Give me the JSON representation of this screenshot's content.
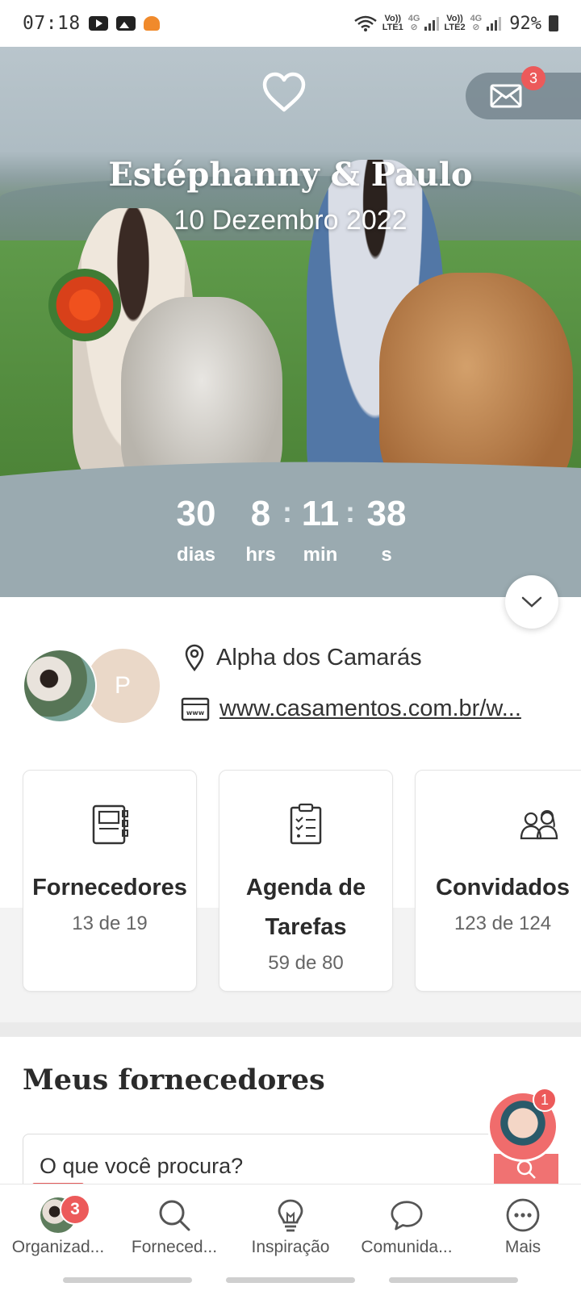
{
  "status_bar": {
    "time": "07:18",
    "net1_top": "Vo))",
    "net1_bottom": "LTE1",
    "net2_top": "Vo))",
    "net2_bottom": "LTE2",
    "net_type": "4G",
    "battery": "92%"
  },
  "header": {
    "couple": "Estéphanny & Paulo",
    "date": "10 Dezembro 2022",
    "messages_badge": "3"
  },
  "countdown": {
    "days": "30",
    "days_label": "dias",
    "hours": "8",
    "hours_label": "hrs",
    "minutes": "11",
    "minutes_label": "min",
    "seconds": "38",
    "seconds_label": "s",
    "separator": ":"
  },
  "profile": {
    "partner_initial": "P",
    "location": "Alpha dos Camarás",
    "website": "www.casamentos.com.br/w..."
  },
  "cards": [
    {
      "title": "Fornecedores",
      "count": "13 de 19",
      "icon": "notebook-icon"
    },
    {
      "title_line1": "Agenda de",
      "title_line2": "Tarefas",
      "count": "59 de 80",
      "icon": "clipboard-checklist-icon"
    },
    {
      "title": "Convidados",
      "count": "123 de 124",
      "icon": "guests-icon"
    }
  ],
  "vendors_section": {
    "title": "Meus fornecedores",
    "search_prompt": "O que você procura?",
    "helper_badge": "1"
  },
  "bottom_nav": {
    "items": [
      {
        "label": "Organizad...",
        "badge": "3",
        "icon": "avatar"
      },
      {
        "label": "Forneced...",
        "icon": "search-icon"
      },
      {
        "label": "Inspiração",
        "icon": "lightbulb-icon"
      },
      {
        "label": "Comunida...",
        "icon": "chat-bubble-icon"
      },
      {
        "label": "Mais",
        "icon": "more-dots-icon"
      }
    ]
  },
  "colors": {
    "accent": "#ec5a5a",
    "countdown_bg": "#9aaab0"
  }
}
